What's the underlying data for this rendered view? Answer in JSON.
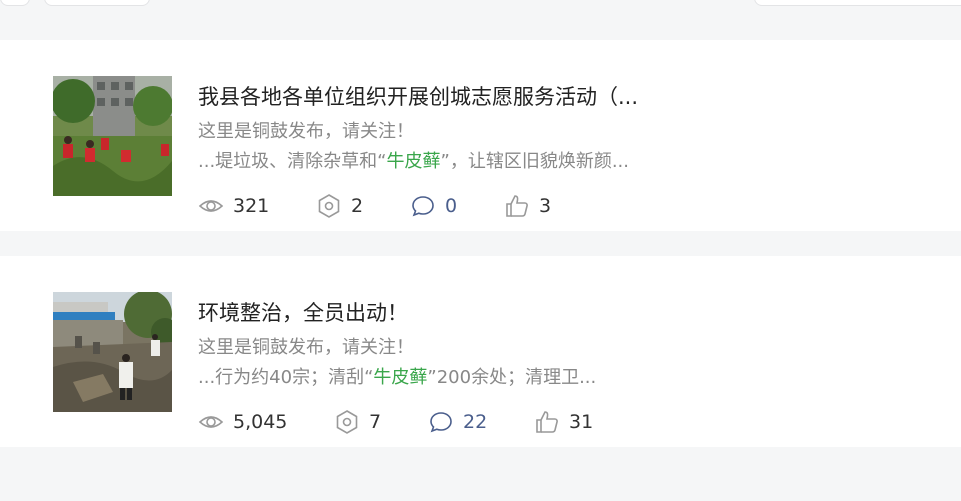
{
  "articles": [
    {
      "title": "我县各地各单位组织开展创城志愿服务活动（...",
      "source": "这里是铜鼓发布，请关注！",
      "excerpt_pre": "...堤垃圾、清除杂草和“",
      "excerpt_keyword": "牛皮藓",
      "excerpt_post": "”，让辖区旧貌焕新颜...",
      "views": "321",
      "shares": "2",
      "comments": "0",
      "likes": "3"
    },
    {
      "title": "环境整治，全员出动！",
      "source": "这里是铜鼓发布，请关注！",
      "excerpt_pre": "...行为约40宗；清刮“",
      "excerpt_keyword": "牛皮藓",
      "excerpt_post": "”200余处；清理卫...",
      "views": "5,045",
      "shares": "7",
      "comments": "22",
      "likes": "31"
    }
  ],
  "icons": {
    "views": "eye-icon",
    "shares": "share-icon",
    "comments": "comment-icon",
    "likes": "thumbs-up-icon"
  },
  "colors": {
    "keyword": "#3aa64b",
    "comment_count": "#4a5e8c",
    "muted_text": "#888888"
  }
}
